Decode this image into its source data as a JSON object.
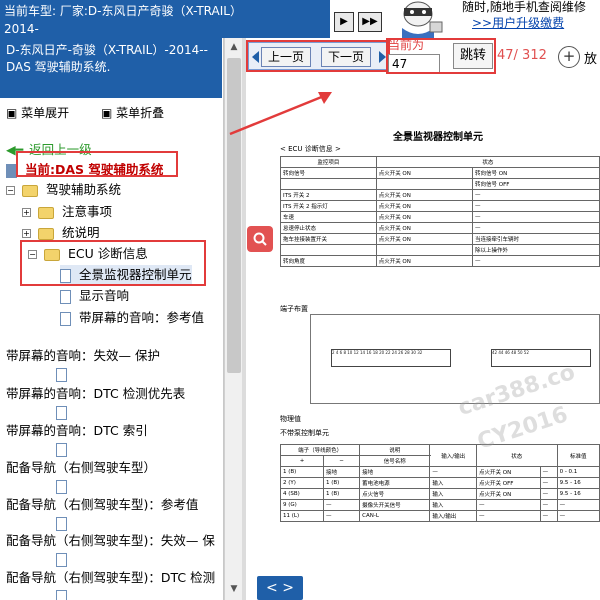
{
  "topbar": {
    "title_line1": "当前车型:  厂家:D-东风日产奇骏（X-TRAIL）",
    "title_line2": "2014-",
    "nav_buttons": [
      "▶",
      "▶▶"
    ],
    "promo_line1": "随时,随地手机查阅维修",
    "promo_link": ">>用户升级缴费"
  },
  "left_panel": {
    "doc_header": "D-东风日产-奇骏（X-TRAIL）-2014-- DAS 驾驶辅助系统.",
    "expand_all": "菜单展开",
    "collapse_all": "菜单折叠",
    "back_link": "返回上一级",
    "current_label": "当前:DAS 驾驶辅助系统",
    "tree": [
      {
        "label": "驾驶辅助系统",
        "kind": "folder",
        "toggle": "−"
      },
      {
        "label": "注意事项",
        "kind": "folder",
        "toggle": "+"
      },
      {
        "label": "统说明",
        "kind": "folder",
        "toggle": "+"
      },
      {
        "label": "ECU 诊断信息",
        "kind": "folder",
        "toggle": "−"
      },
      {
        "label": "全景监视器控制单元",
        "kind": "doc",
        "selected": true
      },
      {
        "label": "显示音响",
        "kind": "doc"
      },
      {
        "label": "带屏幕的音响：参考值",
        "kind": "doc"
      },
      {
        "label": "带屏幕的音响：失效— 保护",
        "kind": "doc"
      },
      {
        "label": "带屏幕的音响：DTC 检测优先表",
        "kind": "doc"
      },
      {
        "label": "带屏幕的音响：DTC 索引",
        "kind": "doc"
      },
      {
        "label": "配备导航（右侧驾驶车型）",
        "kind": "doc"
      },
      {
        "label": "配备导航（右侧驾驶车型)：参考值",
        "kind": "doc"
      },
      {
        "label": "配备导航（右侧驾驶车型)：失效— 保",
        "kind": "doc"
      },
      {
        "label": "配备导航（右侧驾驶车型)：DTC 检测",
        "kind": "doc"
      }
    ]
  },
  "toolbar": {
    "prev_page": "上一页",
    "next_page": "下一页",
    "current_page_label": "当前为",
    "current_page_value": "47",
    "jump_label": "跳转",
    "page_count": "47/ 312",
    "zoom_icon": "+",
    "zoom_label": "放"
  },
  "search_fab_icon": "search-icon",
  "bottom_nav_label": "< >",
  "document": {
    "title": "全景监视器控制单元",
    "section_ecu": "< ECU 诊断信息 >",
    "ecu_table": {
      "headers": [
        "监控项目",
        "状态",
        ""
      ],
      "rows": [
        [
          "转向信号",
          "点火开关 ON",
          "转向信号 ON"
        ],
        [
          "",
          "",
          "转向信号 OFF"
        ],
        [
          "ITS 开关 2",
          "点火开关 ON",
          "—"
        ],
        [
          "ITS 开关 2 指示灯",
          "点火开关 ON",
          "—"
        ],
        [
          "车速",
          "点火开关 ON",
          "—"
        ],
        [
          "怠速停止状态",
          "点火开关 ON",
          "—"
        ],
        [
          "拖车挂接装置开关",
          "点火开关 ON",
          "当连接牵引车辆时"
        ],
        [
          "",
          "",
          "除以上操作外"
        ],
        [
          "转向角度",
          "点火开关 ON",
          "—"
        ]
      ]
    },
    "section_terminal": "端子布置",
    "connector_left": "2 4 6 8 10 12 14 16 18 20 22 24 26 28 30 32",
    "connector_right": "42 44 46 48 50 52",
    "section_physical": "物理值",
    "section_no_control": "不带泵控制单元",
    "phys_table": {
      "headers": [
        "端子（导线颜色）",
        "说明",
        "",
        "输入/输出",
        "状态",
        "",
        "标准值"
      ],
      "subheaders": [
        "+",
        "−",
        "信号名称"
      ],
      "rows": [
        [
          "1 (B)",
          "接地",
          "接地",
          "—",
          "点火开关 ON",
          "—",
          "0 - 0.1"
        ],
        [
          "2 (Y)",
          "1 (B)",
          "蓄电池电源",
          "输入",
          "点火开关 OFF",
          "—",
          "9.5 - 16"
        ],
        [
          "4 (SB)",
          "1 (B)",
          "点火信号",
          "输入",
          "点火开关 ON",
          "—",
          "9.5 - 16"
        ],
        [
          "9 (G)",
          "—",
          "摄像头开关信号",
          "输入",
          "—",
          "—",
          "—"
        ],
        [
          "11 (L)",
          "—",
          "CAN-L",
          "输入/输出",
          "—",
          "—",
          "—"
        ]
      ]
    },
    "watermark_1": "car388.co",
    "watermark_2": "CY2016"
  }
}
